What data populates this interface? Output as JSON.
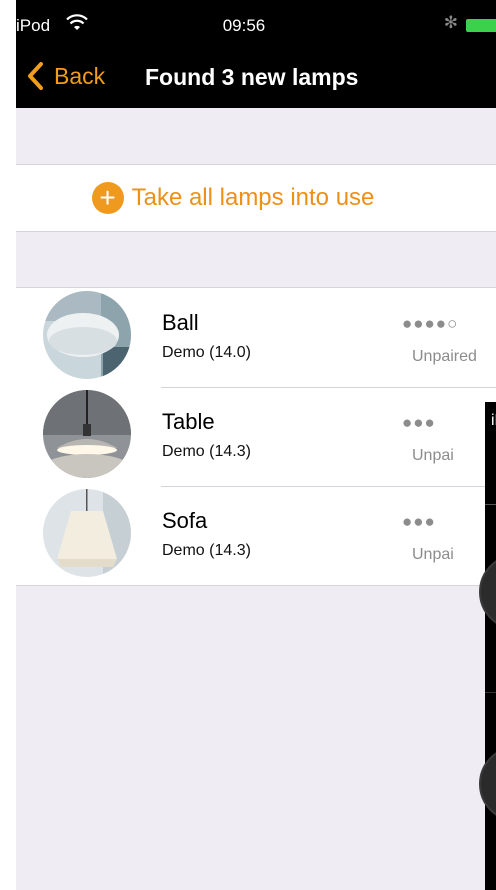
{
  "status_bar": {
    "carrier": "iPod",
    "time": "09:56",
    "bluetooth": "✻"
  },
  "nav": {
    "back_label": "Back",
    "title": "Found 3 new lamps"
  },
  "take_all": {
    "label": "Take all lamps into use",
    "icon": "+"
  },
  "lamps": [
    {
      "name": "Ball",
      "subtitle": "Demo (14.0)",
      "signal": "●●●●○",
      "status": "Unpaired"
    },
    {
      "name": "Table",
      "subtitle": "Demo (14.3)",
      "signal": "●●●",
      "status": "Unpai"
    },
    {
      "name": "Sofa",
      "subtitle": "Demo (14.3)",
      "signal": "●●●",
      "status": "Unpai"
    }
  ],
  "overlay": {
    "carrier": "iP"
  },
  "colors": {
    "accent": "#EE8F16",
    "background": "#EFECF4",
    "bar": "#000000"
  }
}
